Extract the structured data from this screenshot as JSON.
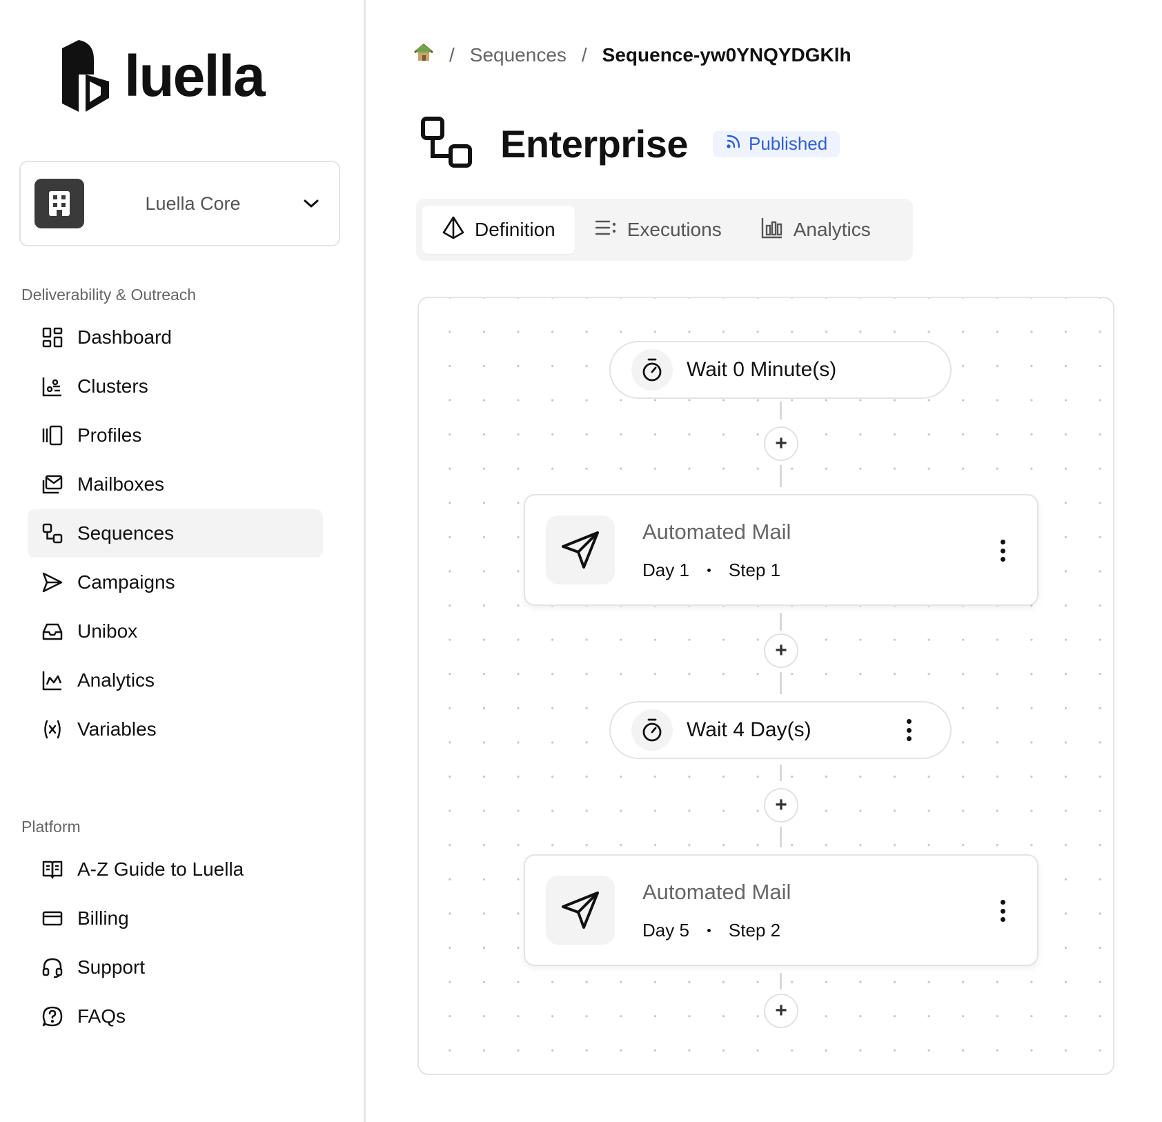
{
  "brand": {
    "name": "luella"
  },
  "workspace": {
    "name": "Luella Core"
  },
  "sidebar": {
    "section1": "Deliverability & Outreach",
    "items1": [
      {
        "label": "Dashboard",
        "icon": "dashboard-icon"
      },
      {
        "label": "Clusters",
        "icon": "clusters-icon"
      },
      {
        "label": "Profiles",
        "icon": "profiles-icon"
      },
      {
        "label": "Mailboxes",
        "icon": "mailboxes-icon"
      },
      {
        "label": "Sequences",
        "icon": "sequences-icon",
        "active": true
      },
      {
        "label": "Campaigns",
        "icon": "send-icon"
      },
      {
        "label": "Unibox",
        "icon": "inbox-icon"
      },
      {
        "label": "Analytics",
        "icon": "analytics-icon"
      },
      {
        "label": "Variables",
        "icon": "variable-icon"
      }
    ],
    "section2": "Platform",
    "items2": [
      {
        "label": "A-Z Guide to Luella",
        "icon": "book-icon"
      },
      {
        "label": "Billing",
        "icon": "credit-card-icon"
      },
      {
        "label": "Support",
        "icon": "headset-icon"
      },
      {
        "label": "FAQs",
        "icon": "help-bubble-icon"
      }
    ]
  },
  "breadcrumb": {
    "home_icon": "home-icon",
    "items": [
      "Sequences",
      "Sequence-yw0YNQYDGKlh"
    ]
  },
  "page": {
    "title": "Enterprise",
    "status": "Published",
    "status_color": "#2f5fd6"
  },
  "tabs": [
    {
      "label": "Definition",
      "icon": "pyramid-icon",
      "active": true
    },
    {
      "label": "Executions",
      "icon": "list-icon"
    },
    {
      "label": "Analytics",
      "icon": "bar-chart-icon"
    }
  ],
  "flow": {
    "wait1": "Wait 0 Minute(s)",
    "mail1": {
      "title": "Automated Mail",
      "day": "Day 1",
      "step": "Step 1"
    },
    "wait2": "Wait 4 Day(s)",
    "mail2": {
      "title": "Automated Mail",
      "day": "Day 5",
      "step": "Step 2"
    },
    "add_label": "+"
  }
}
